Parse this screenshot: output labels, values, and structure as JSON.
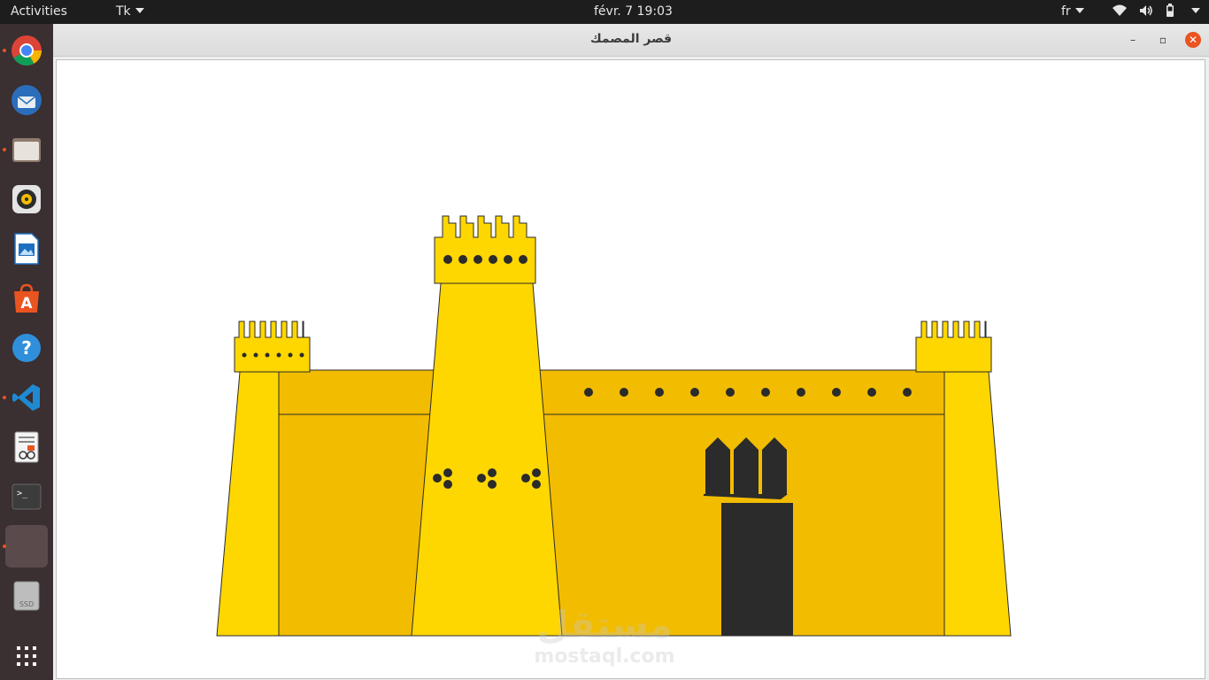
{
  "topbar": {
    "activities": "Activities",
    "app_menu": "Tk",
    "clock": "févr. 7  19:03",
    "language": "fr"
  },
  "dock": {
    "apps": [
      "chrome-icon",
      "thunderbird-icon",
      "files-icon",
      "rhythmbox-icon",
      "writer-icon",
      "software-icon",
      "help-icon",
      "vscode-icon",
      "document-viewer-icon",
      "terminal-icon",
      "tk-window-icon",
      "ssd-drive-icon",
      "show-apps-icon"
    ],
    "ssd_label": "SSD"
  },
  "window": {
    "title": "قصر المصمك",
    "minimize": "–",
    "maximize": "▫",
    "close": "✕"
  },
  "watermark": {
    "arabic": "مستقل",
    "latin": "mostaql.com"
  },
  "colors": {
    "wall": "#f2bc00",
    "tower": "#ffd700",
    "dark": "#2b2b2b",
    "accent_orange": "#e95420"
  }
}
